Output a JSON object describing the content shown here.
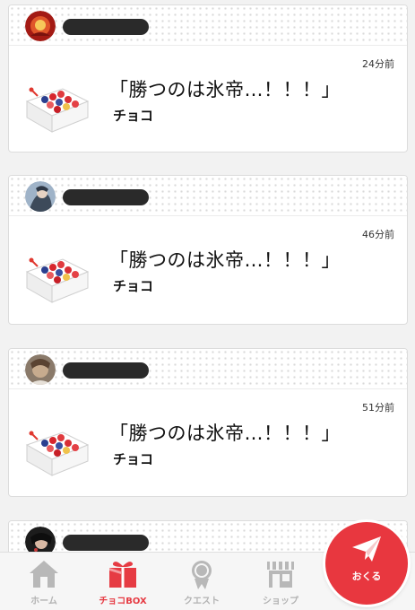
{
  "feed": {
    "items": [
      {
        "time": "24分前",
        "title": "「勝つのは氷帝…！！！」",
        "type": "チョコ",
        "avatar": "avatar-red-icon"
      },
      {
        "time": "46分前",
        "title": "「勝つのは氷帝…！！！」",
        "type": "チョコ",
        "avatar": "avatar-blue-icon"
      },
      {
        "time": "51分前",
        "title": "「勝つのは氷帝…！！！」",
        "type": "チョコ",
        "avatar": "avatar-brown-icon"
      }
    ]
  },
  "tabs": {
    "home": "ホーム",
    "choco_box": "チョコBOX",
    "quest": "クエスト",
    "shop": "ショップ"
  },
  "fab": {
    "label": "おくる"
  },
  "colors": {
    "accent": "#e8373f",
    "inactive": "#b3b3b3"
  }
}
